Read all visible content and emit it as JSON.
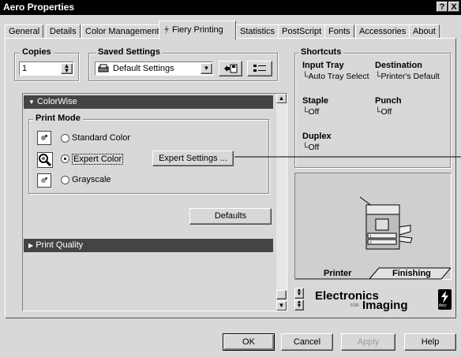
{
  "window": {
    "title": "Aero Properties",
    "help_btn": "?",
    "close_btn": "X"
  },
  "tabs": [
    {
      "label": "General"
    },
    {
      "label": "Details"
    },
    {
      "label": "Color Management"
    },
    {
      "label": "Fiery Printing",
      "active": true
    },
    {
      "label": "Statistics"
    },
    {
      "label": "PostScript"
    },
    {
      "label": "Fonts"
    },
    {
      "label": "Accessories"
    },
    {
      "label": "About"
    }
  ],
  "copies": {
    "label": "Copies",
    "value": "1"
  },
  "saved_settings": {
    "label": "Saved Settings",
    "value": "Default Settings"
  },
  "colorwise": {
    "header": "ColorWise",
    "print_mode_label": "Print Mode",
    "options": [
      {
        "label": "Standard Color",
        "selected": false
      },
      {
        "label": "Expert Color",
        "selected": true
      },
      {
        "label": "Grayscale",
        "selected": false
      }
    ],
    "expert_settings_btn": "Expert Settings ...",
    "defaults_btn": "Defaults"
  },
  "print_quality": {
    "header": "Print Quality"
  },
  "shortcuts": {
    "label": "Shortcuts",
    "items": [
      {
        "title": "Input Tray",
        "value": "Auto Tray Select"
      },
      {
        "title": "Destination",
        "value": "Printer's Default"
      },
      {
        "title": "Staple",
        "value": "Off"
      },
      {
        "title": "Punch",
        "value": "Off"
      },
      {
        "title": "Duplex",
        "value": "Off"
      }
    ]
  },
  "preview": {
    "tab_printer": "Printer",
    "tab_finishing": "Finishing"
  },
  "brand": {
    "line1": "Electronics",
    "prefix": "FOR",
    "line2": "Imaging",
    "fiery": "fiery"
  },
  "footer": {
    "ok": "OK",
    "cancel": "Cancel",
    "apply": "Apply",
    "help": "Help"
  },
  "colors": {
    "titlebar": "#000000",
    "dark_bar": "#444444",
    "window_bg": "#d8d8d8"
  }
}
